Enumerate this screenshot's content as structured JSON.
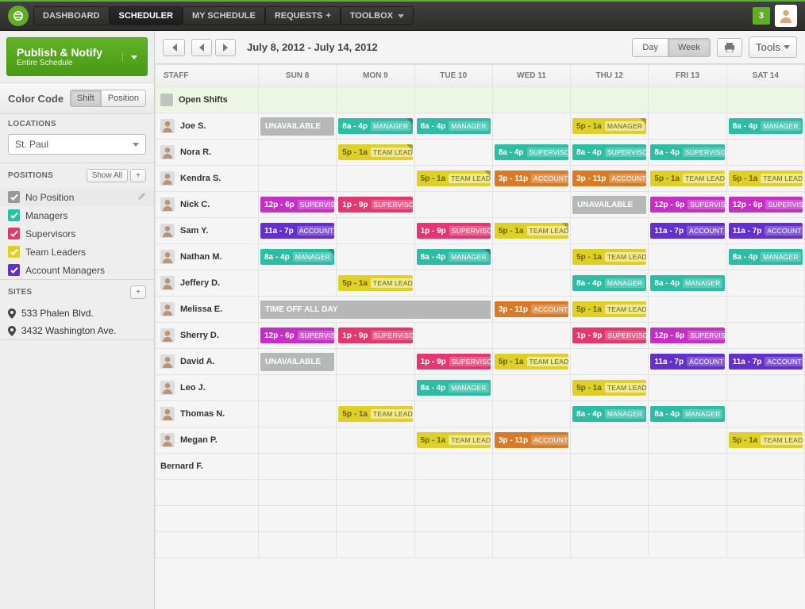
{
  "nav": {
    "items": [
      "DASHBOARD",
      "SCHEDULER",
      "MY SCHEDULE",
      "REQUESTS",
      "TOOLBOX"
    ],
    "active": "SCHEDULER",
    "badge": "3"
  },
  "sidebar": {
    "publish_title": "Publish & Notify",
    "publish_sub": "Entire Schedule",
    "colorcode_label": "Color Code",
    "colorcode_opts": [
      "Shift",
      "Position"
    ],
    "colorcode_active": "Shift",
    "locations_label": "LOCATIONS",
    "location_value": "St. Paul",
    "positions_label": "POSITIONS",
    "show_all": "Show All",
    "positions": [
      {
        "label": "No Position",
        "color": "no-pos",
        "editable": true
      },
      {
        "label": "Managers",
        "color": "teal"
      },
      {
        "label": "Supervisors",
        "color": "pink"
      },
      {
        "label": "Team Leaders",
        "color": "yellow"
      },
      {
        "label": "Account Managers",
        "color": "purple"
      }
    ],
    "sites_label": "SITES",
    "sites": [
      "533 Phalen Blvd.",
      "3432 Washington Ave."
    ]
  },
  "toolbar": {
    "date_range": "July 8, 2012 - July 14, 2012",
    "day": "Day",
    "week": "Week",
    "tools": "Tools"
  },
  "headers": [
    "STAFF",
    "SUN 8",
    "MON 9",
    "TUE 10",
    "WED 11",
    "THU 12",
    "FRI 13",
    "SAT 14"
  ],
  "open_shifts_label": "Open Shifts",
  "staff": [
    {
      "name": "Joe S.",
      "cells": [
        {
          "type": "unavail",
          "text": "UNAVAILABLE"
        },
        {
          "type": "shift",
          "color": "teal",
          "time": "8a - 4p",
          "role": "MANAGER",
          "corner": true
        },
        {
          "type": "shift",
          "color": "teal",
          "time": "8a - 4p",
          "role": "MANAGER"
        },
        null,
        {
          "type": "shift",
          "color": "yellow",
          "time": "5p - 1a",
          "role": "MANAGER",
          "corner": true
        },
        null,
        {
          "type": "shift",
          "color": "teal",
          "time": "8a - 4p",
          "role": "MANAGER"
        }
      ]
    },
    {
      "name": "Nora R.",
      "cells": [
        null,
        {
          "type": "shift",
          "color": "yellow",
          "time": "5p - 1a",
          "role": "TEAM LEADE",
          "corner": true
        },
        null,
        {
          "type": "shift",
          "color": "teal",
          "time": "8a - 4p",
          "role": "SUPERVISOR"
        },
        {
          "type": "shift",
          "color": "teal",
          "time": "8a - 4p",
          "role": "SUPERVISOR"
        },
        {
          "type": "shift",
          "color": "teal",
          "time": "8a - 4p",
          "role": "SUPERVISOR"
        },
        null
      ]
    },
    {
      "name": "Kendra S.",
      "cells": [
        null,
        null,
        {
          "type": "shift",
          "color": "yellow",
          "time": "5p - 1a",
          "role": "TEAM LEADE",
          "corner": true
        },
        {
          "type": "shift",
          "color": "orange",
          "time": "3p - 11p",
          "role": "ACCOUNT M"
        },
        {
          "type": "shift",
          "color": "orange",
          "time": "3p - 11p",
          "role": "ACCOUNT M"
        },
        {
          "type": "shift",
          "color": "yellow",
          "time": "5p - 1a",
          "role": "TEAM LEADE"
        },
        {
          "type": "shift",
          "color": "yellow",
          "time": "5p - 1a",
          "role": "TEAM LEADE"
        }
      ]
    },
    {
      "name": "Nick C.",
      "cells": [
        {
          "type": "shift",
          "color": "magenta",
          "time": "12p - 6p",
          "role": "SUPERVISO"
        },
        {
          "type": "shift",
          "color": "pink",
          "time": "1p - 9p",
          "role": "SUPERVISO"
        },
        null,
        null,
        {
          "type": "unavail",
          "text": "UNAVAILABLE"
        },
        {
          "type": "shift",
          "color": "magenta",
          "time": "12p - 6p",
          "role": "SUPERVISO"
        },
        {
          "type": "shift",
          "color": "magenta",
          "time": "12p - 6p",
          "role": "SUPERVISO"
        }
      ]
    },
    {
      "name": "Sam Y.",
      "cells": [
        {
          "type": "shift",
          "color": "purple",
          "time": "11a - 7p",
          "role": "ACCOUNT M"
        },
        null,
        {
          "type": "shift",
          "color": "pink",
          "time": "1p - 9p",
          "role": "SUPERVISO"
        },
        {
          "type": "shift",
          "color": "yellow",
          "time": "5p - 1a",
          "role": "TEAM LEADE",
          "corner": true
        },
        null,
        {
          "type": "shift",
          "color": "purple",
          "time": "11a - 7p",
          "role": "ACCOUNT M"
        },
        {
          "type": "shift",
          "color": "purple",
          "time": "11a - 7p",
          "role": "ACCOUNT M"
        }
      ]
    },
    {
      "name": "Nathan M.",
      "cells": [
        {
          "type": "shift",
          "color": "teal",
          "time": "8a - 4p",
          "role": "MANAGER",
          "corner": true
        },
        null,
        {
          "type": "shift",
          "color": "teal",
          "time": "8a - 4p",
          "role": "MANAGER",
          "corner": true
        },
        null,
        {
          "type": "shift",
          "color": "yellow",
          "time": "5p - 1a",
          "role": "TEAM LEADE"
        },
        null,
        {
          "type": "shift",
          "color": "teal",
          "time": "8a - 4p",
          "role": "MANAGER"
        }
      ]
    },
    {
      "name": "Jeffery D.",
      "cells": [
        null,
        {
          "type": "shift",
          "color": "yellow",
          "time": "5p - 1a",
          "role": "TEAM LEADE"
        },
        null,
        null,
        {
          "type": "shift",
          "color": "teal",
          "time": "8a - 4p",
          "role": "MANAGER"
        },
        {
          "type": "shift",
          "color": "teal",
          "time": "8a - 4p",
          "role": "MANAGER"
        },
        null
      ]
    },
    {
      "name": "Melissa E.",
      "cells": [
        {
          "type": "timeoff",
          "span": 3,
          "text": "TIME OFF ALL DAY"
        },
        null,
        null,
        {
          "type": "shift",
          "color": "orange",
          "time": "3p - 11p",
          "role": "ACCOUNT M"
        },
        {
          "type": "shift",
          "color": "yellow",
          "time": "5p - 1a",
          "role": "TEAM LEADE"
        },
        null,
        null
      ]
    },
    {
      "name": "Sherry D.",
      "cells": [
        {
          "type": "shift",
          "color": "magenta",
          "time": "12p - 6p",
          "role": "SUPERVISO"
        },
        {
          "type": "shift",
          "color": "pink",
          "time": "1p - 9p",
          "role": "SUPERVISO"
        },
        null,
        null,
        {
          "type": "shift",
          "color": "pink",
          "time": "1p - 9p",
          "role": "SUPERVISO"
        },
        {
          "type": "shift",
          "color": "magenta",
          "time": "12p - 6p",
          "role": "SUPERVISO"
        },
        null
      ]
    },
    {
      "name": "David A.",
      "cells": [
        {
          "type": "unavail",
          "text": "UNAVAILABLE"
        },
        null,
        {
          "type": "shift",
          "color": "pink",
          "time": "1p - 9p",
          "role": "SUPERVISO"
        },
        {
          "type": "shift",
          "color": "yellow",
          "time": "5p - 1a",
          "role": "TEAM LEADE"
        },
        null,
        {
          "type": "shift",
          "color": "purple",
          "time": "11a - 7p",
          "role": "ACCOUNT M"
        },
        {
          "type": "shift",
          "color": "purple",
          "time": "11a - 7p",
          "role": "ACCOUNT M"
        }
      ]
    },
    {
      "name": "Leo J.",
      "cells": [
        null,
        null,
        {
          "type": "shift",
          "color": "teal",
          "time": "8a - 4p",
          "role": "MANAGER"
        },
        null,
        {
          "type": "shift",
          "color": "yellow",
          "time": "5p - 1a",
          "role": "TEAM LEADE"
        },
        null,
        null
      ]
    },
    {
      "name": "Thomas N.",
      "cells": [
        null,
        {
          "type": "shift",
          "color": "yellow",
          "time": "5p - 1a",
          "role": "TEAM LEADE"
        },
        null,
        null,
        {
          "type": "shift",
          "color": "teal",
          "time": "8a - 4p",
          "role": "MANAGER"
        },
        {
          "type": "shift",
          "color": "teal",
          "time": "8a - 4p",
          "role": "MANAGER"
        },
        null
      ]
    },
    {
      "name": "Megan P.",
      "cells": [
        null,
        null,
        {
          "type": "shift",
          "color": "yellow",
          "time": "5p - 1a",
          "role": "TEAM LEADE"
        },
        {
          "type": "shift",
          "color": "orange",
          "time": "3p - 11p",
          "role": "ACCOUNT M"
        },
        null,
        null,
        {
          "type": "shift",
          "color": "yellow",
          "time": "5p - 1a",
          "role": "TEAM LEADE"
        }
      ]
    },
    {
      "name": "Bernard F.",
      "no_avatar": true,
      "cells": [
        null,
        null,
        null,
        null,
        null,
        null,
        null
      ]
    }
  ],
  "blank_rows": 3
}
